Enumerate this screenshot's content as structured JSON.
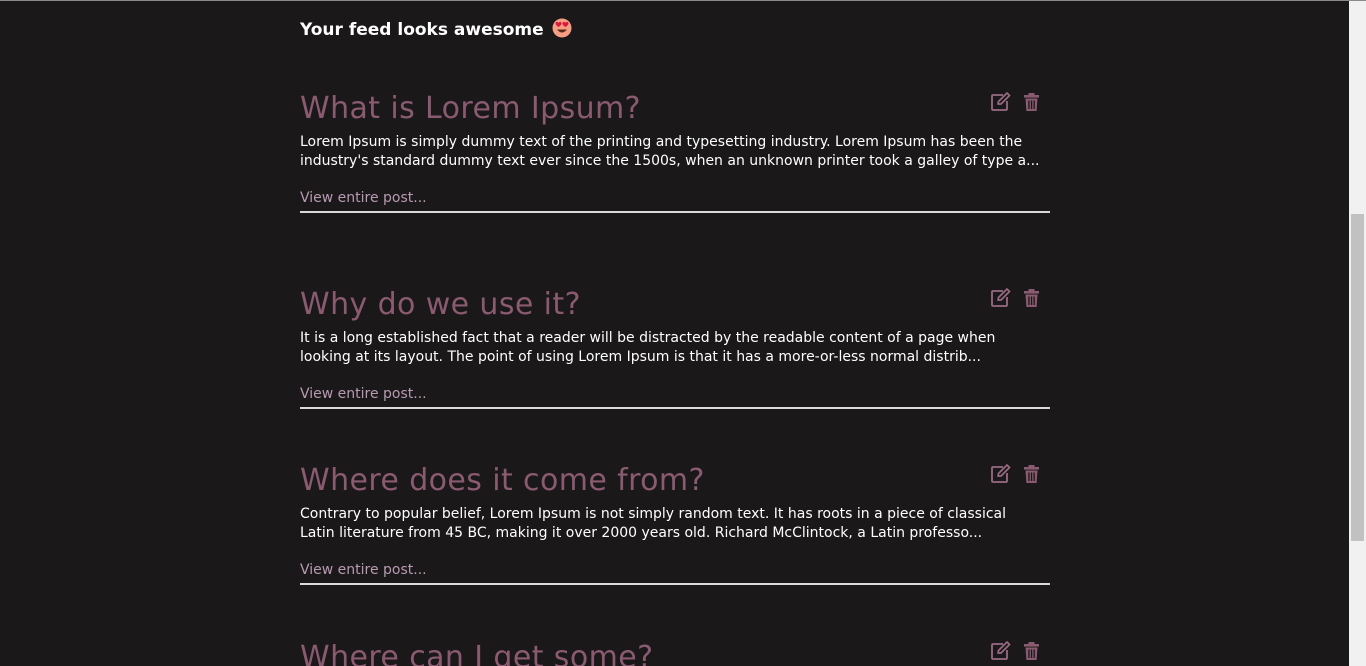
{
  "feed": {
    "heading": "Your feed looks awesome",
    "heading_emoji": "smiling-face-with-heart-eyes-emoji"
  },
  "posts": [
    {
      "title": "What is Lorem Ipsum?",
      "excerpt": "Lorem Ipsum is simply dummy text of the printing and typesetting industry. Lorem Ipsum has been the industry's standard dummy text ever since the 1500s, when an unknown printer took a galley of type a...",
      "link_label": "View entire post..."
    },
    {
      "title": "Why do we use it?",
      "excerpt": "It is a long established fact that a reader will be distracted by the readable content of a page when looking at its layout. The point of using Lorem Ipsum is that it has a more-or-less normal distrib...",
      "link_label": "View entire post..."
    },
    {
      "title": "Where does it come from?",
      "excerpt": "Contrary to popular belief, Lorem Ipsum is not simply random text. It has roots in a piece of classical Latin literature from 45 BC, making it over 2000 years old. Richard McClintock, a Latin professo...",
      "link_label": "View entire post..."
    },
    {
      "title": "Where can I get some?",
      "excerpt": "",
      "link_label": ""
    }
  ],
  "icons": {
    "edit": "edit-icon",
    "delete": "trash-icon"
  },
  "colors": {
    "background": "#1a1818",
    "post_title": "#8a5a70",
    "link": "#b89ab2",
    "text": "#ffffff",
    "divider": "#d9d9d9"
  }
}
